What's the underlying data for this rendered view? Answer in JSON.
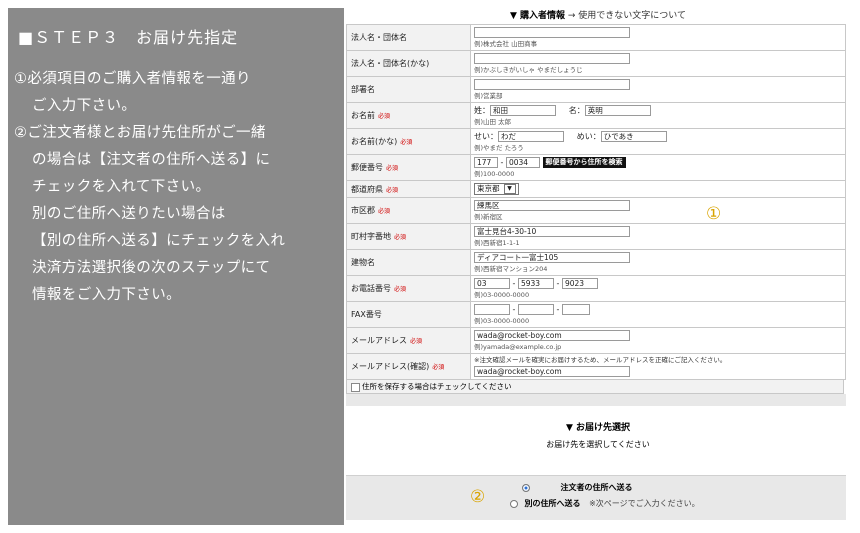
{
  "left": {
    "title": "■ＳＴＥＰ３　お届け先指定",
    "lines": [
      "①必須項目のご購入者情報を一通り",
      "ご入力下さい。",
      "②ご注文者様とお届け先住所がご一緒",
      "の場合は【注文者の住所へ送る】に",
      "チェックを入れて下さい。",
      "別のご住所へ送りたい場合は",
      "【別の住所へ送る】にチェックを入れ",
      "決済方法選択後の次のステップにて",
      "情報をご入力下さい。"
    ]
  },
  "form": {
    "header_title": "▼ 購入者情報",
    "header_link": "→ 使用できない文字について",
    "required_label": "必須",
    "rows": {
      "corp": {
        "label": "法人名・団体名",
        "example": "例)株式会社 山田商事"
      },
      "corp_kana": {
        "label": "法人名・団体名(かな)",
        "example": "例)かぶしきがいしゃ やまだしょうじ"
      },
      "dept": {
        "label": "部署名",
        "example": "例)営業部"
      },
      "name": {
        "label": "お名前",
        "sei_label": "姓：",
        "sei_value": "和田",
        "mei_label": "名：",
        "mei_value": "英明",
        "example": "例)山田 太郎"
      },
      "name_kana": {
        "label": "お名前(かな)",
        "sei_label": "せい：",
        "sei_value": "わだ",
        "mei_label": "めい：",
        "mei_value": "ひであき",
        "example": "例)やまだ たろう"
      },
      "zip": {
        "label": "郵便番号",
        "zip1": "177",
        "zip2": "0034",
        "button": "郵便番号から住所を検索",
        "example": "例)100-0000"
      },
      "pref": {
        "label": "都道府県",
        "value": "東京都",
        "arrow": "▼"
      },
      "city": {
        "label": "市区郡",
        "value": "練馬区",
        "example": "例)新宿区"
      },
      "town": {
        "label": "町村字番地",
        "value": "富士見台4-30-10",
        "example": "例)西新宿1-1-1"
      },
      "building": {
        "label": "建物名",
        "value": "ディアコート一富士105",
        "example": "例)西新宿マンション204"
      },
      "tel": {
        "label": "お電話番号",
        "t1": "03",
        "t2": "5933",
        "t3": "9023",
        "example": "例)03-0000-0000"
      },
      "fax": {
        "label": "FAX番号",
        "example": "例)03-0000-0000"
      },
      "mail": {
        "label": "メールアドレス",
        "value": "wada@rocket-boy.com",
        "example": "例)yamada@example.co.jp"
      },
      "mail_confirm": {
        "label": "メールアドレス(確認)",
        "note": "※注文確認メールを確実にお届けするため、メールアドレスを正確にご記入ください。",
        "value": "wada@rocket-boy.com"
      }
    },
    "save_label": "住所を保存する場合はチェックしてください",
    "marker1": "①"
  },
  "destination": {
    "title": "▼ お届け先選択",
    "subtitle": "お届け先を選択してください",
    "option1": "注文者の住所へ送る",
    "option2": "別の住所へ送る",
    "option2_note": "※次ページでご入力ください。",
    "marker2": "②"
  },
  "colors": {
    "frame": "#8a8a8a",
    "required": "#d00000",
    "marker": "#d9a400"
  }
}
